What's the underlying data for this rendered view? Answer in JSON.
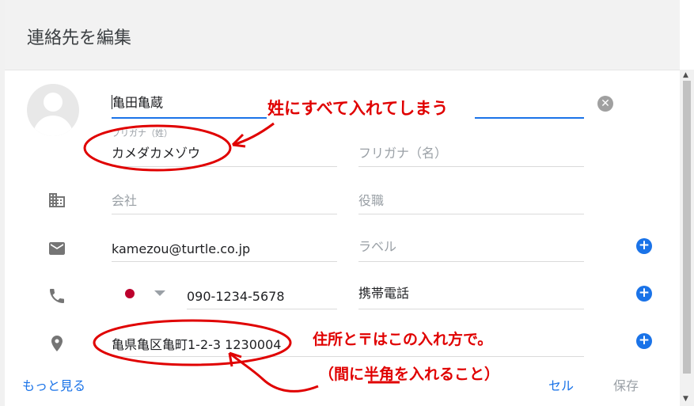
{
  "dialog": {
    "title": "連絡先を編集"
  },
  "name": {
    "family_value": "亀田亀蔵",
    "given_value": ""
  },
  "furigana": {
    "family_label": "フリガナ（姓）",
    "family_value": "カメダカメゾウ",
    "given_placeholder": "フリガナ（名）"
  },
  "company": {
    "company_placeholder": "会社",
    "title_placeholder": "役職"
  },
  "email": {
    "value": "kamezou@turtle.co.jp",
    "label_placeholder": "ラベル"
  },
  "phone": {
    "country": "JP",
    "value": "090-1234-5678",
    "label_value": "携帯電話"
  },
  "address": {
    "value": "亀県亀区亀町1-2-3 1230004"
  },
  "footer": {
    "more_label": "もっと見る",
    "cancel_label": "セル",
    "save_label": "保存"
  },
  "annotations": {
    "note1": "姓にすべて入れてしまう",
    "note2": "住所と〒はこの入れ方で。",
    "note3_prefix": "（間に",
    "note3_emphasis": "半角",
    "note3_suffix": "を入れること）"
  },
  "colors": {
    "accent": "#1a73e8",
    "annotation": "#e00000",
    "header_bg": "#f2f2f2"
  }
}
